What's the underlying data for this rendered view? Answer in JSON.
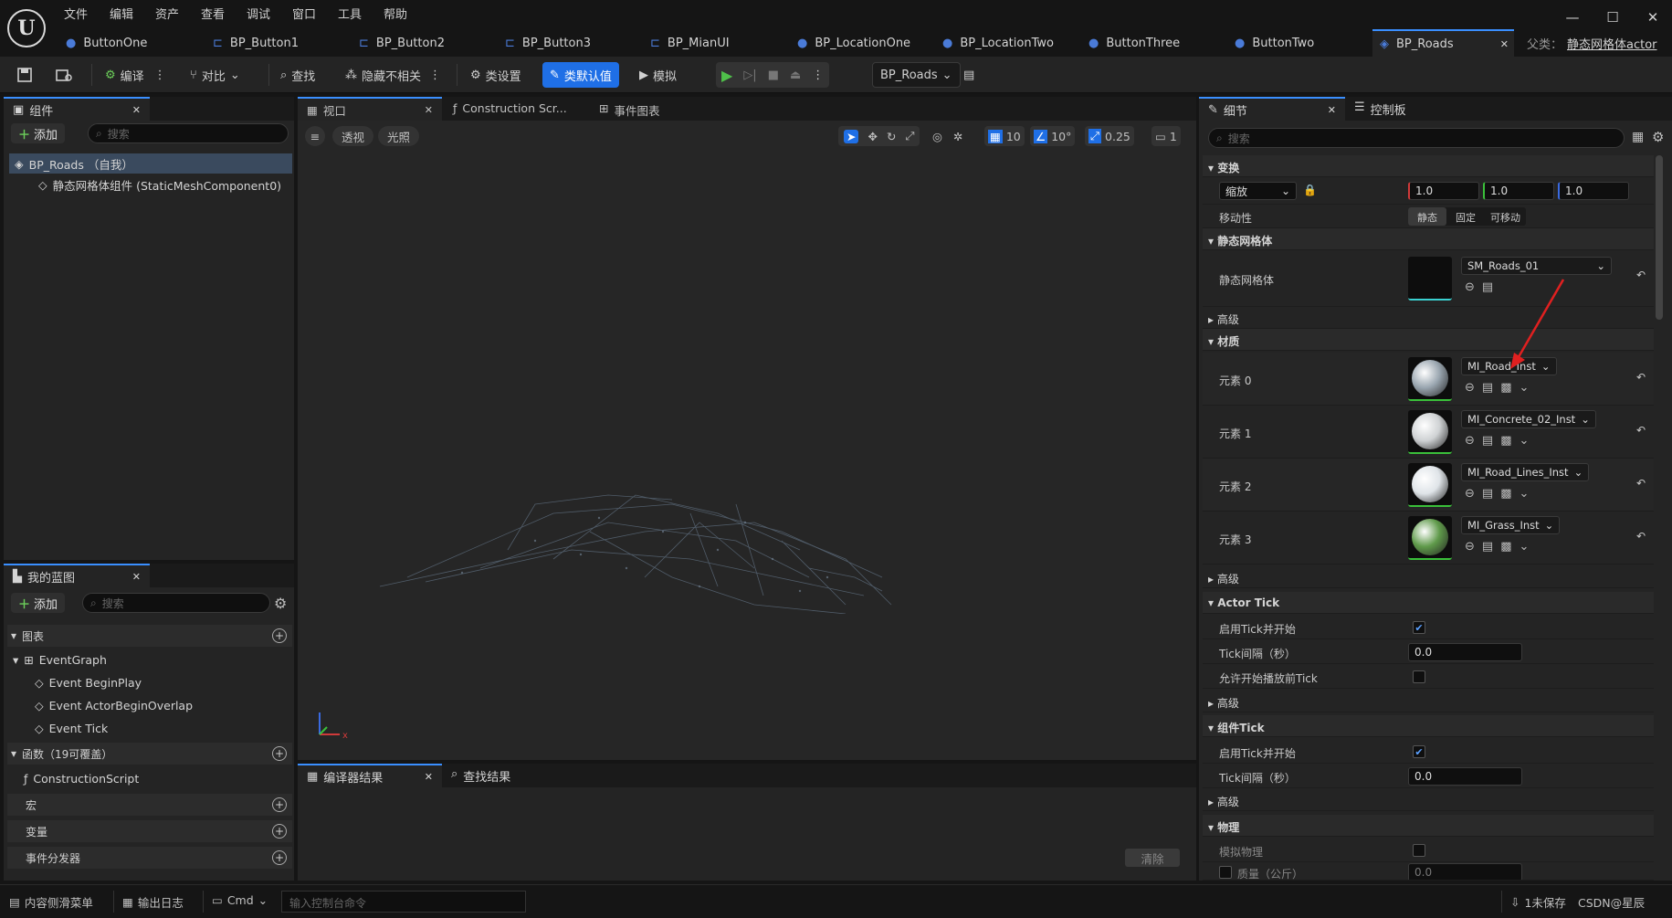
{
  "menu": [
    "文件",
    "编辑",
    "资产",
    "查看",
    "调试",
    "窗口",
    "工具",
    "帮助"
  ],
  "tabs": [
    "ButtonOne",
    "BP_Button1",
    "BP_Button2",
    "BP_Button3",
    "BP_MianUI",
    "BP_LocationOne",
    "BP_LocationTwo",
    "ButtonThree",
    "ButtonTwo",
    "BP_Roads"
  ],
  "parent_label": "父类：",
  "parent_value": "静态网格体actor",
  "toolbar": {
    "compile": "编译",
    "diff": "对比",
    "find": "查找",
    "hide": "隐藏不相关",
    "class_settings": "类设置",
    "class_defaults": "类默认值",
    "simulate": "模拟",
    "debug_target": "BP_Roads"
  },
  "components": {
    "title": "组件",
    "add": "添加",
    "search_ph": "搜索",
    "root": "BP_Roads （自我）",
    "child": "静态网格体组件 (StaticMeshComponent0)"
  },
  "my_blueprint": {
    "title": "我的蓝图",
    "add": "添加",
    "search_ph": "搜索",
    "graphs_label": "图表",
    "event_graph": "EventGraph",
    "events": [
      "Event BeginPlay",
      "Event ActorBeginOverlap",
      "Event Tick"
    ],
    "functions_label": "函数（19可覆盖）",
    "construction": "ConstructionScript",
    "macros": "宏",
    "variables": "变量",
    "dispatchers": "事件分发器"
  },
  "center_tabs": {
    "viewport": "视口",
    "construction": "Construction Scr...",
    "event_graph": "事件图表"
  },
  "viewport": {
    "perspective": "透视",
    "lit": "光照",
    "grid": "10",
    "angle": "10°",
    "scale": "0.25",
    "camera": "1"
  },
  "compiler": {
    "results": "编译器结果",
    "find": "查找结果",
    "clear": "清除"
  },
  "details": {
    "title": "细节",
    "control": "控制板",
    "search_ph": "搜索",
    "transform": "变换",
    "scale_label": "缩放",
    "scale_x": "1.0",
    "scale_y": "1.0",
    "scale_z": "1.0",
    "mobility": "移动性",
    "mobility_opts": [
      "静态",
      "固定",
      "可移动"
    ],
    "static_mesh_sec": "静态网格体",
    "static_mesh_label": "静态网格体",
    "mesh_value": "SM_Roads_01",
    "advanced": "高级",
    "materials_sec": "材质",
    "elements": [
      {
        "label": "元素 0",
        "value": "MI_Road_Inst",
        "color": "#9aa6b0"
      },
      {
        "label": "元素 1",
        "value": "MI_Concrete_02_Inst",
        "color": "#cfd2d4"
      },
      {
        "label": "元素 2",
        "value": "MI_Road_Lines_Inst",
        "color": "#dfe4e8"
      },
      {
        "label": "元素 3",
        "value": "MI_Grass_Inst",
        "color": "#5f9a4a"
      }
    ],
    "actor_tick": "Actor Tick",
    "tick_enable": "启用Tick并开始",
    "tick_interval": "Tick间隔（秒）",
    "tick_interval_val": "0.0",
    "tick_before": "允许开始播放前Tick",
    "component_tick": "组件Tick",
    "ctick_enable": "启用Tick并开始",
    "ctick_interval": "Tick间隔（秒）",
    "ctick_interval_val": "0.0",
    "physics": "物理",
    "simulate_physics": "模拟物理",
    "mass": "质量（公斤）",
    "mass_val": "0.0"
  },
  "status": {
    "content_drawer": "内容侧滑菜单",
    "output_log": "输出日志",
    "cmd": "Cmd",
    "console_ph": "输入控制台命令",
    "unsaved": "1未保存",
    "source_control": "CSDN@星辰"
  },
  "colors": {
    "accent": "#1f6fe6",
    "bg": "#151515",
    "panel": "#242424"
  }
}
